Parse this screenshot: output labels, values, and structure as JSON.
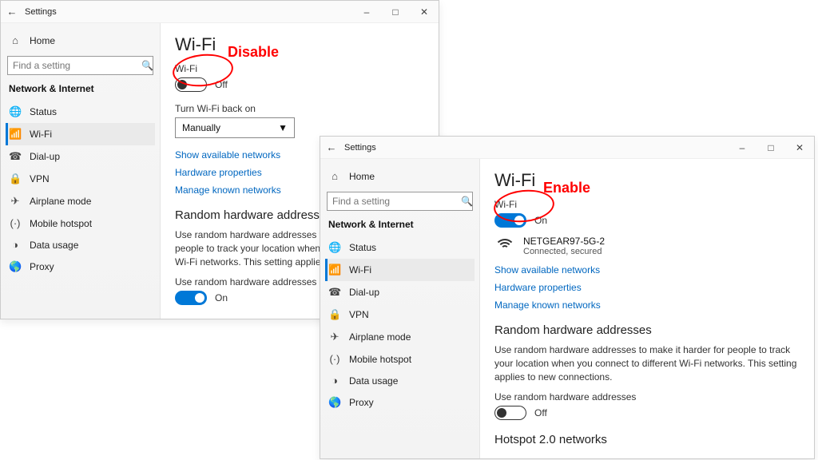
{
  "windowTitle": "Settings",
  "homeLabel": "Home",
  "searchPlaceholder": "Find a setting",
  "sectionHeader": "Network & Internet",
  "navItems": [
    {
      "label": "Status",
      "icon": "status"
    },
    {
      "label": "Wi-Fi",
      "icon": "wifi"
    },
    {
      "label": "Dial-up",
      "icon": "dialup"
    },
    {
      "label": "VPN",
      "icon": "vpn"
    },
    {
      "label": "Airplane mode",
      "icon": "airplane"
    },
    {
      "label": "Mobile hotspot",
      "icon": "hotspot"
    },
    {
      "label": "Data usage",
      "icon": "datausage"
    },
    {
      "label": "Proxy",
      "icon": "proxy"
    }
  ],
  "page": {
    "title": "Wi-Fi",
    "wifiLabel": "Wi-Fi",
    "turnBackOnLabel": "Turn Wi-Fi back on",
    "turnBackOnValue": "Manually",
    "links": {
      "showNetworks": "Show available networks",
      "hardwareProps": "Hardware properties",
      "manageNetworks": "Manage known networks"
    },
    "randomSection": "Random hardware addresses",
    "randomDesc": "Use random hardware addresses to make it harder for people to track your location when you connect to different Wi-Fi networks. This setting applies to new connections.",
    "useRandomLabel": "Use random hardware addresses",
    "hotspot2Section": "Hotspot 2.0 networks"
  },
  "win1": {
    "wifiToggle": {
      "state": "Off",
      "on": false
    },
    "randomToggle": {
      "state": "On",
      "on": true
    }
  },
  "win2": {
    "wifiToggle": {
      "state": "On",
      "on": true
    },
    "network": {
      "name": "NETGEAR97-5G-2",
      "status": "Connected, secured"
    },
    "randomToggle": {
      "state": "Off",
      "on": false
    }
  },
  "annotations": {
    "disable": "Disable",
    "enable": "Enable"
  }
}
